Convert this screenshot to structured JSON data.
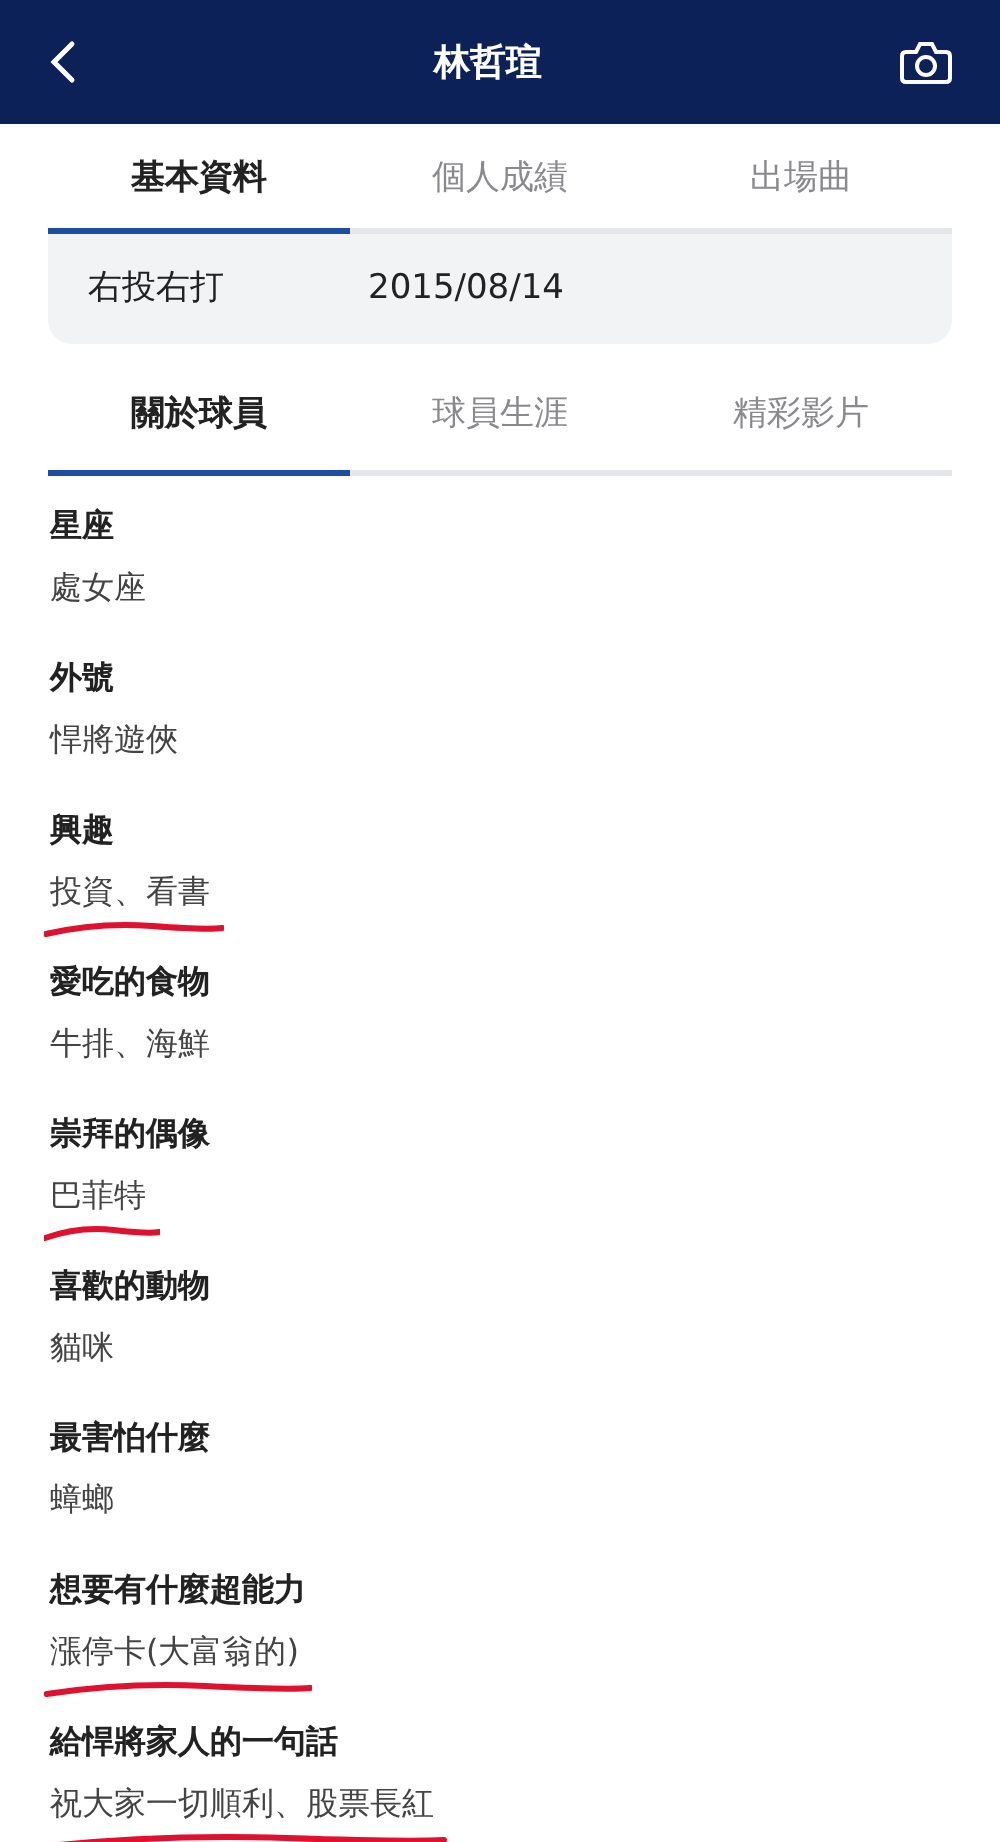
{
  "header": {
    "title": "林哲瑄"
  },
  "tabs": [
    {
      "label": "基本資料",
      "selected": true
    },
    {
      "label": "個人成績",
      "selected": false
    },
    {
      "label": "出場曲",
      "selected": false
    }
  ],
  "summary_card": {
    "values": [
      "右投右打",
      "2015/08/14"
    ]
  },
  "sub_tabs": [
    {
      "label": "關於球員",
      "selected": true
    },
    {
      "label": "球員生涯",
      "selected": false
    },
    {
      "label": "精彩影片",
      "selected": false
    }
  ],
  "details": [
    {
      "label": "星座",
      "value": "處女座",
      "underlined": false
    },
    {
      "label": "外號",
      "value": "悍將遊俠",
      "underlined": false
    },
    {
      "label": "興趣",
      "value": "投資、看書",
      "underlined": true
    },
    {
      "label": "愛吃的食物",
      "value": "牛排、海鮮",
      "underlined": false
    },
    {
      "label": "崇拜的偶像",
      "value": "巴菲特",
      "underlined": true
    },
    {
      "label": "喜歡的動物",
      "value": "貓咪",
      "underlined": false
    },
    {
      "label": "最害怕什麼",
      "value": "蟑螂",
      "underlined": false
    },
    {
      "label": "想要有什麼超能力",
      "value": "漲停卡(大富翁的)",
      "underlined": true
    },
    {
      "label": "給悍將家人的一句話",
      "value": "祝大家一切順利、股票長紅",
      "underlined": true
    }
  ]
}
